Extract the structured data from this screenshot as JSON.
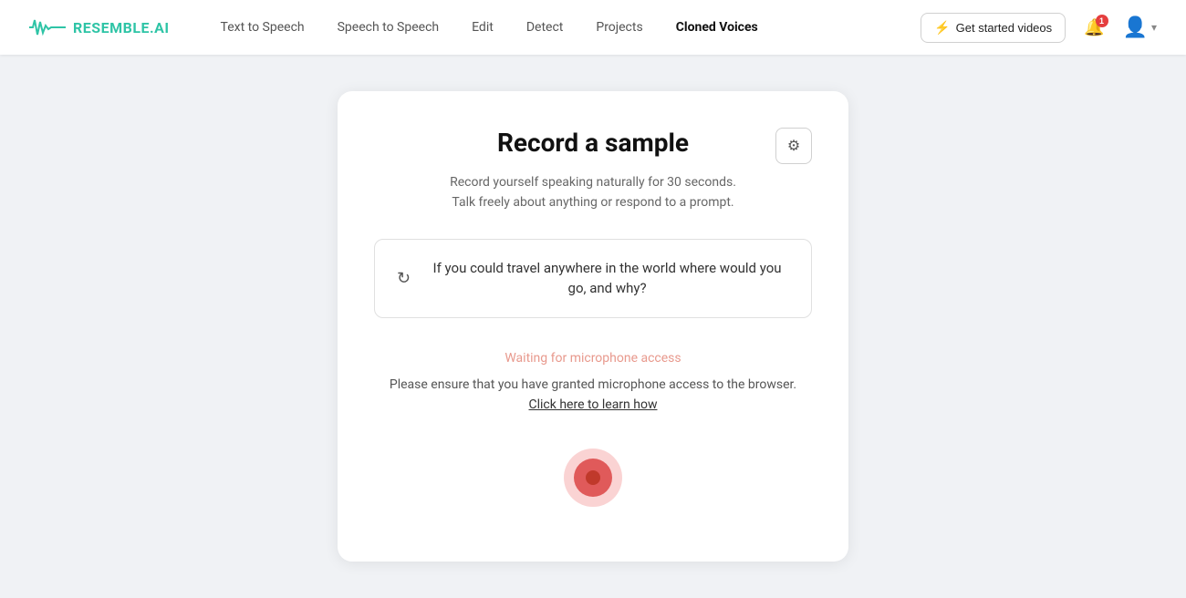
{
  "nav": {
    "logo_text": "RESEMBLE.AI",
    "links": [
      {
        "label": "Text to Speech",
        "active": false
      },
      {
        "label": "Speech to Speech",
        "active": false
      },
      {
        "label": "Edit",
        "active": false
      },
      {
        "label": "Detect",
        "active": false
      },
      {
        "label": "Projects",
        "active": false
      },
      {
        "label": "Cloned Voices",
        "active": true
      }
    ],
    "get_started_label": "Get started videos",
    "notification_count": "1"
  },
  "card": {
    "title": "Record a sample",
    "subtitle_line1": "Record yourself speaking naturally for 30 seconds.",
    "subtitle_line2": "Talk freely about anything or respond to a prompt.",
    "prompt": "If you could travel anywhere in the world where would you go, and why?",
    "mic_waiting": "Waiting for microphone access",
    "mic_desc_before": "Please ensure that you have granted microphone access to the",
    "mic_desc_mid": "browser.",
    "mic_link": "Click here to learn how"
  }
}
